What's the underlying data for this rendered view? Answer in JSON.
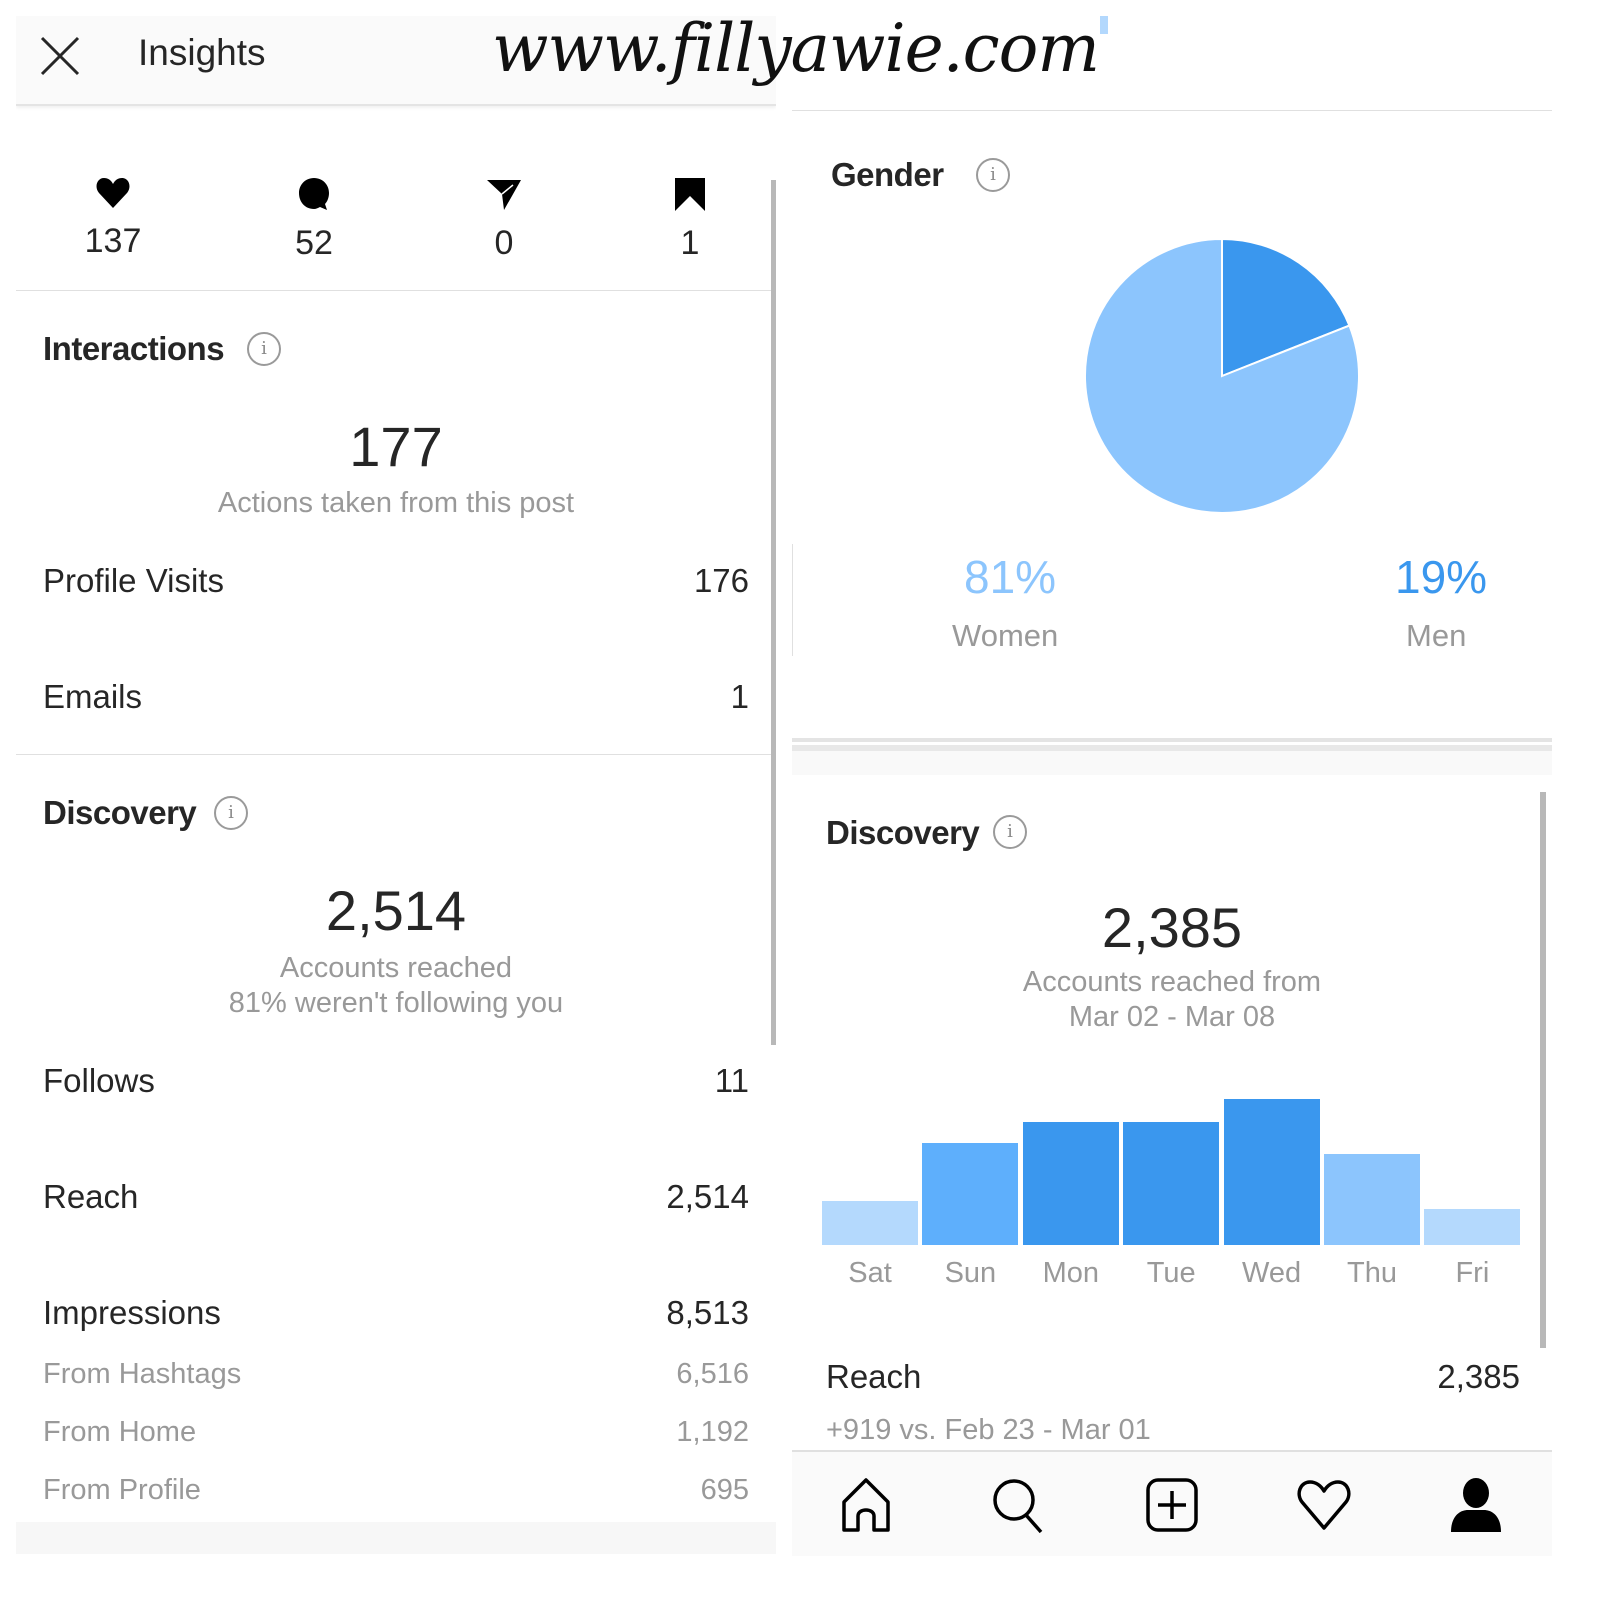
{
  "watermark": "www.fillyawie.com",
  "left_panel": {
    "header": {
      "title": "Insights",
      "close_icon": "close-icon"
    },
    "post_stats": [
      {
        "icon": "heart-filled-icon",
        "value": "137"
      },
      {
        "icon": "comment-filled-icon",
        "value": "52"
      },
      {
        "icon": "send-filled-icon",
        "value": "0"
      },
      {
        "icon": "bookmark-filled-icon",
        "value": "1"
      }
    ],
    "interactions": {
      "title": "Interactions",
      "info_icon": "i",
      "total": "177",
      "caption": "Actions taken from this post",
      "rows": [
        {
          "label": "Profile Visits",
          "value": "176"
        },
        {
          "label": "Emails",
          "value": "1"
        }
      ]
    },
    "discovery": {
      "title": "Discovery",
      "info_icon": "i",
      "total": "2,514",
      "caption_line1": "Accounts reached",
      "caption_line2": "81% weren't following you",
      "rows": [
        {
          "label": "Follows",
          "value": "11"
        },
        {
          "label": "Reach",
          "value": "2,514"
        },
        {
          "label": "Impressions",
          "value": "8,513"
        }
      ],
      "impression_sources": [
        {
          "label": "From Hashtags",
          "value": "6,516"
        },
        {
          "label": "From Home",
          "value": "1,192"
        },
        {
          "label": "From Profile",
          "value": "695"
        }
      ]
    }
  },
  "right_panel": {
    "gender": {
      "title": "Gender",
      "info_icon": "i",
      "women_pct": "81%",
      "women_label": "Women",
      "men_pct": "19%",
      "men_label": "Men"
    },
    "discovery": {
      "title": "Discovery",
      "info_icon": "i",
      "total": "2,385",
      "caption_line1": "Accounts reached from",
      "caption_line2": "Mar 02 - Mar 08",
      "reach_label": "Reach",
      "reach_value": "2,385",
      "compare_text": "+919 vs. Feb 23 - Mar 01"
    },
    "tabbar": [
      {
        "name": "tab-home",
        "icon": "home-icon"
      },
      {
        "name": "tab-search",
        "icon": "search-icon"
      },
      {
        "name": "tab-new-post",
        "icon": "add-post-icon"
      },
      {
        "name": "tab-activity",
        "icon": "heart-outline-icon"
      },
      {
        "name": "tab-profile",
        "icon": "profile-icon"
      }
    ]
  },
  "colors": {
    "pie_women": "#8cc5fd",
    "pie_men": "#3a97ee",
    "women_pct_text": "#8cc5fd",
    "men_pct_text": "#3a97ee",
    "bar_dark": "#3a97ee",
    "bar_mid": "#5eaffc",
    "bar_light": "#8cc5fd",
    "bar_lightest": "#b4d9fd"
  },
  "chart_data": [
    {
      "type": "pie",
      "title": "Gender",
      "categories": [
        "Women",
        "Men"
      ],
      "values": [
        81,
        19
      ],
      "unit": "%",
      "start_angle": "12 o'clock, clockwise (Men first)"
    },
    {
      "type": "bar",
      "title": "Accounts reached from Mar 02 - Mar 08",
      "categories": [
        "Sat",
        "Sun",
        "Mon",
        "Tue",
        "Wed",
        "Thu",
        "Fri"
      ],
      "values": [
        0.3,
        0.7,
        0.84,
        0.84,
        1.0,
        0.62,
        0.25
      ],
      "value_note": "relative to Wed (max); no y-axis shown",
      "shade": [
        "lightest",
        "mid",
        "dark",
        "dark",
        "dark",
        "light",
        "lightest"
      ],
      "xlabel": "",
      "ylabel": "",
      "grid": false,
      "legend": "none"
    }
  ]
}
